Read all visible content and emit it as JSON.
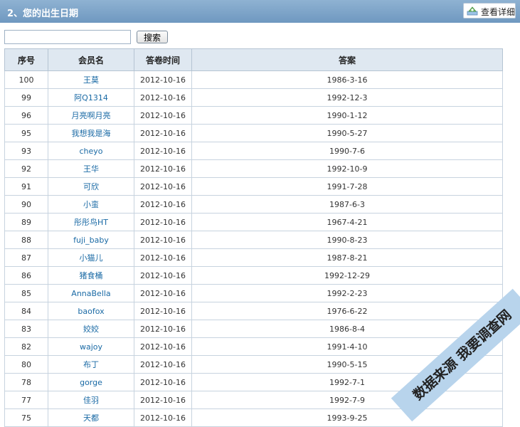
{
  "header": {
    "title": "2、您的出生日期",
    "detail_label": "查看详细"
  },
  "search": {
    "button_label": "搜索",
    "value": "",
    "placeholder": ""
  },
  "table": {
    "columns": [
      "序号",
      "会员名",
      "答卷时间",
      "答案"
    ],
    "rows": [
      [
        "100",
        "王莫",
        "2012-10-16",
        "1986-3-16"
      ],
      [
        "99",
        "阿Q1314",
        "2012-10-16",
        "1992-12-3"
      ],
      [
        "96",
        "月亮啊月亮",
        "2012-10-16",
        "1990-1-12"
      ],
      [
        "95",
        "我想我是海",
        "2012-10-16",
        "1990-5-27"
      ],
      [
        "93",
        "cheyo",
        "2012-10-16",
        "1990-7-6"
      ],
      [
        "92",
        "王华",
        "2012-10-16",
        "1992-10-9"
      ],
      [
        "91",
        "可欣",
        "2012-10-16",
        "1991-7-28"
      ],
      [
        "90",
        "小蛮",
        "2012-10-16",
        "1987-6-3"
      ],
      [
        "89",
        "彤彤鸟HT",
        "2012-10-16",
        "1967-4-21"
      ],
      [
        "88",
        "fuji_baby",
        "2012-10-16",
        "1990-8-23"
      ],
      [
        "87",
        "小猫儿",
        "2012-10-16",
        "1987-8-21"
      ],
      [
        "86",
        "猪食桶",
        "2012-10-16",
        "1992-12-29"
      ],
      [
        "85",
        "AnnaBella",
        "2012-10-16",
        "1992-2-23"
      ],
      [
        "84",
        "baofox",
        "2012-10-16",
        "1976-6-22"
      ],
      [
        "83",
        "姣姣",
        "2012-10-16",
        "1986-8-4"
      ],
      [
        "82",
        "wajoy",
        "2012-10-16",
        "1991-4-10"
      ],
      [
        "80",
        "布丁",
        "2012-10-16",
        "1990-5-15"
      ],
      [
        "78",
        "gorge",
        "2012-10-16",
        "1992-7-1"
      ],
      [
        "77",
        "佳羽",
        "2012-10-16",
        "1992-7-9"
      ],
      [
        "75",
        "天都",
        "2012-10-16",
        "1993-9-25"
      ]
    ]
  },
  "watermark": {
    "text": "数据来源 我要调查网"
  },
  "colors": {
    "header_bg": "#7fa6cc",
    "link": "#1a6aa5",
    "table_header_bg": "#dfe8f1",
    "watermark_bg": "#b8d4ec"
  }
}
